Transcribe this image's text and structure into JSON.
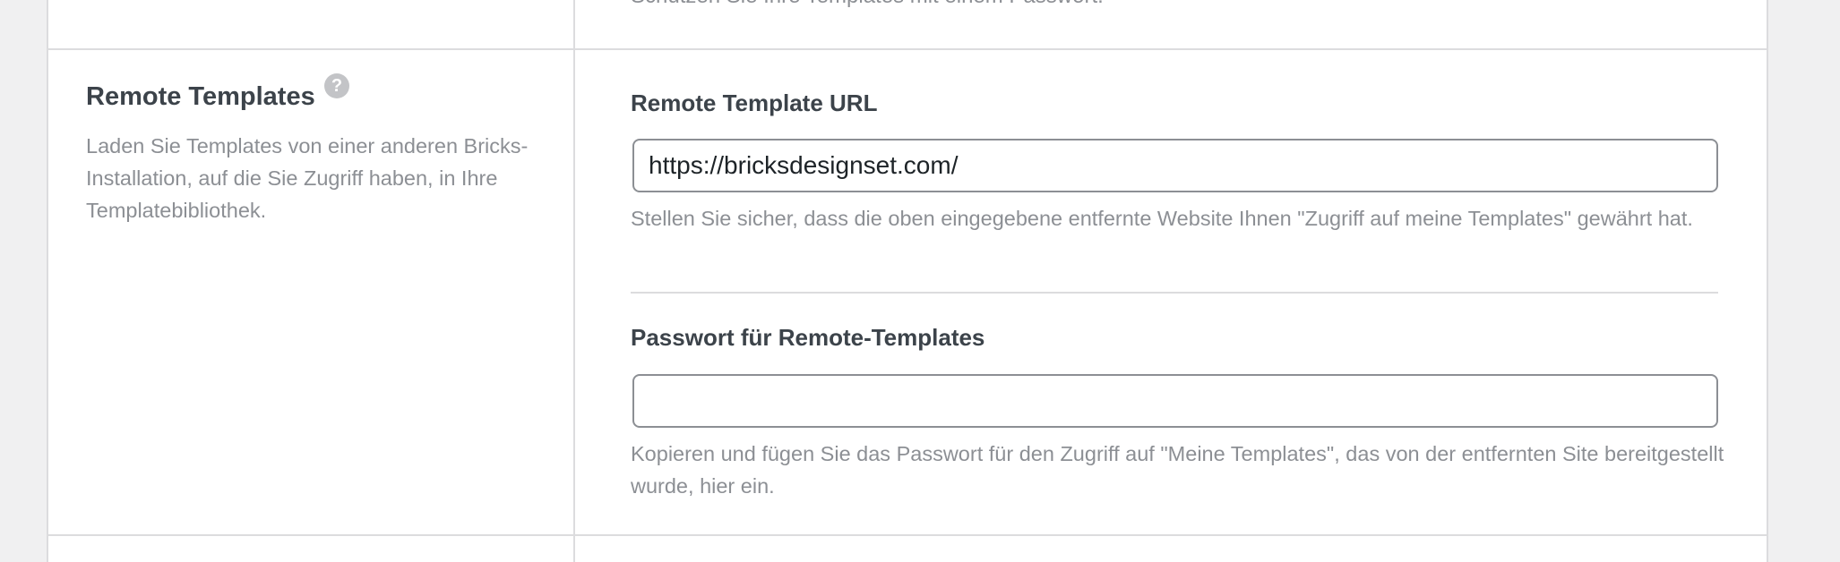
{
  "previous_row": {
    "description_partial": "Schützen Sie Ihre Templates mit einem Passwort."
  },
  "remote_templates": {
    "title": "Remote Templates",
    "help_icon": "question-mark-icon",
    "description": "Laden Sie Templates von einer anderen Bricks-Installation, auf die Sie Zugriff haben, in Ihre Templatebibliothek.",
    "url_field": {
      "label": "Remote Template URL",
      "value": "https://bricksdesignset.com/",
      "help": "Stellen Sie sicher, dass die oben eingegebene entfernte Website Ihnen \"Zugriff auf meine Templates\" gewährt hat."
    },
    "password_field": {
      "label": "Passwort für Remote-Templates",
      "value": "",
      "help": "Kopieren und fügen Sie das Passwort für den Zugriff auf \"Meine Templates\", das von der entfernten Site bereitgestellt wurde, hier ein."
    }
  }
}
